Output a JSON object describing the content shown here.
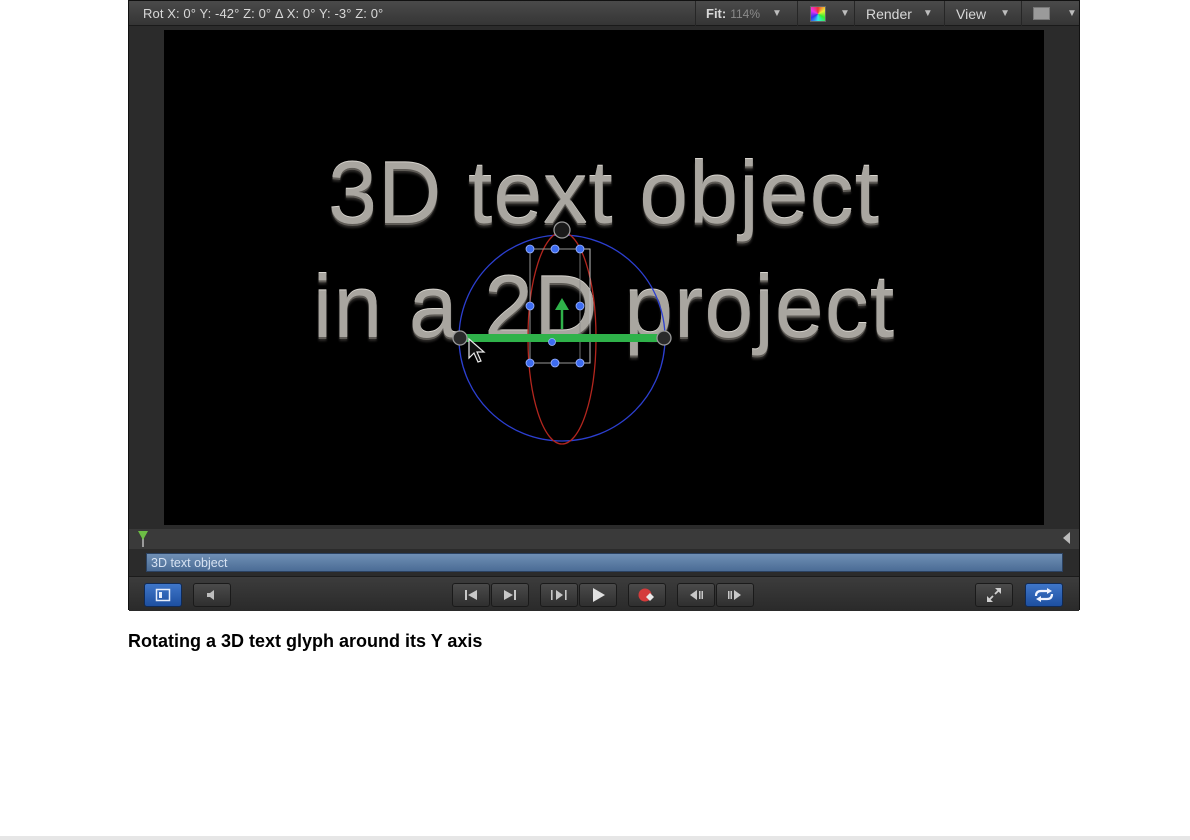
{
  "toolbar": {
    "rotation_readout": "Rot  X: 0° Y: -42° Z: 0°  Δ  X: 0° Y: -3° Z: 0°",
    "fit_label": "Fit:",
    "fit_value": "114%",
    "render_label": "Render",
    "view_label": "View",
    "dropdown_arrow": "▼"
  },
  "canvas": {
    "line1": "3D text object",
    "line2": "in a 2D project"
  },
  "timeline": {
    "track_label": "3D text object"
  },
  "caption": "Rotating a 3D text glyph around its Y axis",
  "colors": {
    "accent_blue": "#2a5fb5",
    "record_red": "#d43b3b",
    "gizmo_green": "#2fb24a",
    "gizmo_red": "#b3261e",
    "gizmo_blue": "#2c3fd0"
  }
}
